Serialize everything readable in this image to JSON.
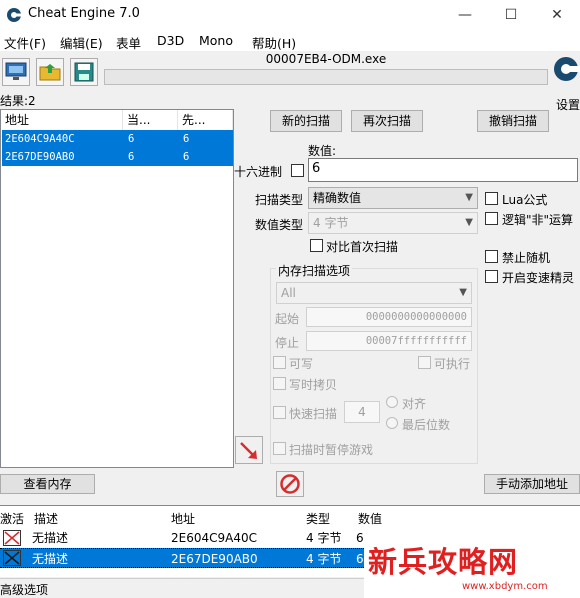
{
  "window": {
    "title": "Cheat Engine 7.0",
    "minimize": "—",
    "maximize": "☐",
    "close": "✕"
  },
  "menu": [
    "文件(F)",
    "编辑(E)",
    "表单",
    "D3D",
    "Mono",
    "帮助(H)"
  ],
  "process": {
    "name": "00007EB4-ODM.exe",
    "settings_label": "设置"
  },
  "results": {
    "count_label": "结果:2",
    "columns": [
      "地址",
      "当...",
      "先..."
    ],
    "rows": [
      {
        "address": "2E604C9A40C",
        "current": "6",
        "previous": "6"
      },
      {
        "address": "2E67DE90AB0",
        "current": "6",
        "previous": "6"
      }
    ]
  },
  "scan": {
    "new_scan": "新的扫描",
    "next_scan": "再次扫描",
    "undo_scan": "撤销扫描",
    "value_label": "数值:",
    "hex_label": "十六进制",
    "value": "6",
    "scan_type_label": "扫描类型",
    "scan_type": "精确数值",
    "value_type_label": "数值类型",
    "value_type": "4 字节",
    "compare_first": "对比首次扫描",
    "lua_formula": "Lua公式",
    "logic_not": "逻辑\"非\"运算",
    "disable_random": "禁止随机",
    "speedhack": "开启变速精灵"
  },
  "memory_options": {
    "title": "内存扫描选项",
    "region": "All",
    "start_label": "起始",
    "start": "0000000000000000",
    "stop_label": "停止",
    "stop": "00007fffffffffff",
    "writable": "可写",
    "executable": "可执行",
    "copy_on_write": "写时拷贝",
    "fast_scan": "快速扫描",
    "fast_scan_value": "4",
    "aligned": "对齐",
    "last_digits": "最后位数",
    "pause_game": "扫描时暂停游戏"
  },
  "buttons": {
    "view_memory": "查看内存",
    "add_manual": "手动添加地址"
  },
  "address_list": {
    "columns": [
      "激活",
      "描述",
      "地址",
      "类型",
      "数值"
    ],
    "rows": [
      {
        "description": "无描述",
        "address": "2E604C9A40C",
        "type": "4 字节",
        "value": "6"
      },
      {
        "description": "无描述",
        "address": "2E67DE90AB0",
        "type": "4 字节",
        "value": "6"
      }
    ]
  },
  "status": {
    "advanced": "高级选项"
  },
  "watermark": {
    "text": "新兵攻略网",
    "url": "www.xbdym.com"
  },
  "colors": {
    "selection": "#0078d7",
    "accent_red": "#d32f2f",
    "watermark_red": "#e02020"
  }
}
